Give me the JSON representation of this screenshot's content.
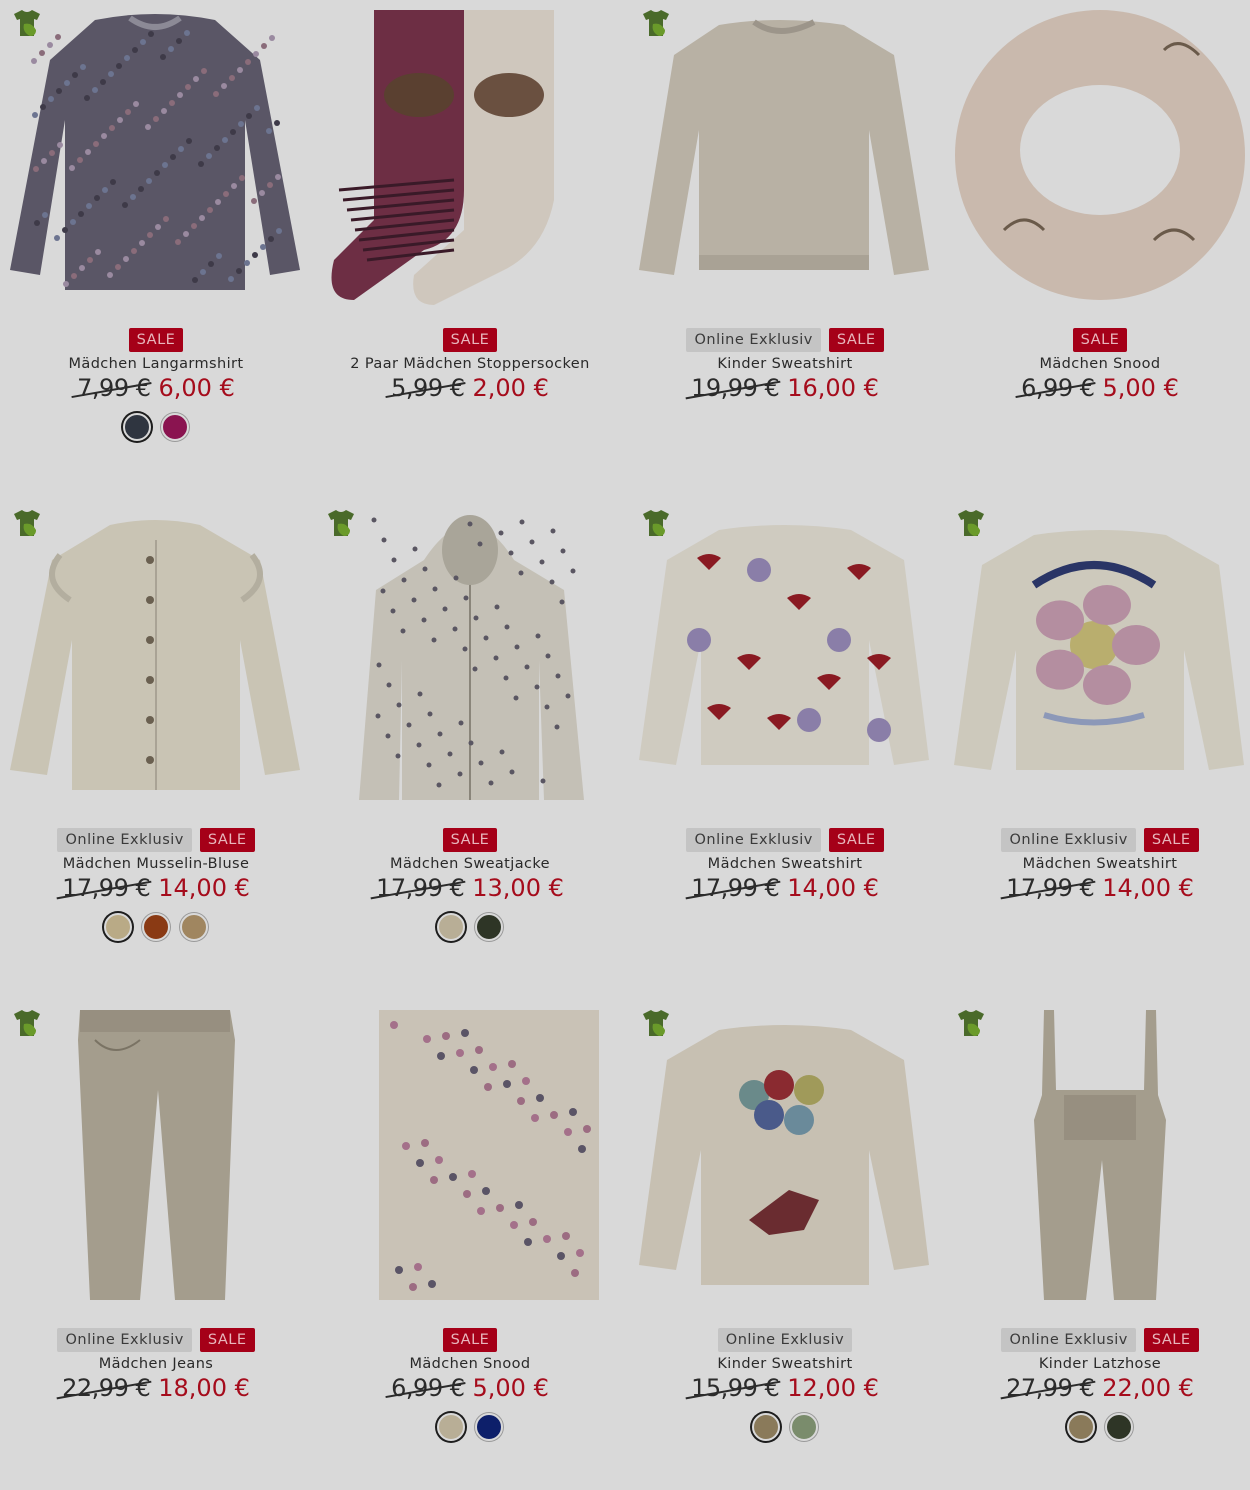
{
  "colors": {
    "sale_bg": "#a50018",
    "sale_text": "#e8b6bc",
    "price_new": "#a50c1c",
    "online_bg": "#c4c4c4",
    "background": "#d9d9d9"
  },
  "products": [
    {
      "name": "Mädchen Langarmshirt",
      "badges": [
        "SALE"
      ],
      "old_price": "7,99 €",
      "new_price": "6,00 €",
      "eco": true,
      "icon": "floral-longsleeve-shirt-image",
      "swatches": [
        "#2f3540",
        "#8a1450"
      ]
    },
    {
      "name": "2 Paar Mädchen Stoppersocken",
      "badges": [
        "SALE"
      ],
      "old_price": "5,99 €",
      "new_price": "2,00 €",
      "eco": false,
      "icon": "horse-socks-image",
      "swatches": []
    },
    {
      "name": "Kinder Sweatshirt",
      "badges": [
        "Online Exklusiv",
        "SALE"
      ],
      "old_price": "19,99 €",
      "new_price": "16,00 €",
      "eco": true,
      "icon": "beige-sweatshirt-image",
      "swatches": []
    },
    {
      "name": "Mädchen Snood",
      "badges": [
        "SALE"
      ],
      "old_price": "6,99 €",
      "new_price": "5,00 €",
      "eco": false,
      "icon": "horse-snood-image",
      "swatches": []
    },
    {
      "name": "Mädchen Musselin-Bluse",
      "badges": [
        "Online Exklusiv",
        "SALE"
      ],
      "old_price": "17,99 €",
      "new_price": "14,00 €",
      "eco": true,
      "icon": "muslin-blouse-image",
      "swatches": [
        "#b9aa86",
        "#8a3a14",
        "#a08660"
      ]
    },
    {
      "name": "Mädchen Sweatjacke",
      "badges": [
        "SALE"
      ],
      "old_price": "17,99 €",
      "new_price": "13,00 €",
      "eco": true,
      "icon": "hooded-sweatjacket-image",
      "swatches": [
        "#b8ae96",
        "#2e3526"
      ]
    },
    {
      "name": "Mädchen Sweatshirt",
      "badges": [
        "Online Exklusiv",
        "SALE"
      ],
      "old_price": "17,99 €",
      "new_price": "14,00 €",
      "eco": true,
      "icon": "strawberry-sweatshirt-image",
      "swatches": []
    },
    {
      "name": "Mädchen Sweatshirt",
      "badges": [
        "Online Exklusiv",
        "SALE"
      ],
      "old_price": "17,99 €",
      "new_price": "14,00 €",
      "eco": true,
      "icon": "flower-mood-sweatshirt-image",
      "swatches": []
    },
    {
      "name": "Mädchen Jeans",
      "badges": [
        "Online Exklusiv",
        "SALE"
      ],
      "old_price": "22,99 €",
      "new_price": "18,00 €",
      "eco": true,
      "icon": "beige-jeans-image",
      "swatches": []
    },
    {
      "name": "Mädchen Snood",
      "badges": [
        "SALE"
      ],
      "old_price": "6,99 €",
      "new_price": "5,00 €",
      "eco": false,
      "icon": "butterfly-snood-image",
      "swatches": [
        "#b8ae96",
        "#0d1f6a"
      ]
    },
    {
      "name": "Kinder Sweatshirt",
      "badges": [
        "Online Exklusiv"
      ],
      "old_price": "15,99 €",
      "new_price": "12,00 €",
      "eco": true,
      "icon": "dog-balloon-sweatshirt-image",
      "swatches": [
        "#8a7a5a",
        "#7a8c6c"
      ]
    },
    {
      "name": "Kinder Latzhose",
      "badges": [
        "Online Exklusiv",
        "SALE"
      ],
      "old_price": "27,99 €",
      "new_price": "22,00 €",
      "eco": true,
      "icon": "dungarees-image",
      "swatches": [
        "#8a7a5a",
        "#2e3526"
      ]
    }
  ]
}
